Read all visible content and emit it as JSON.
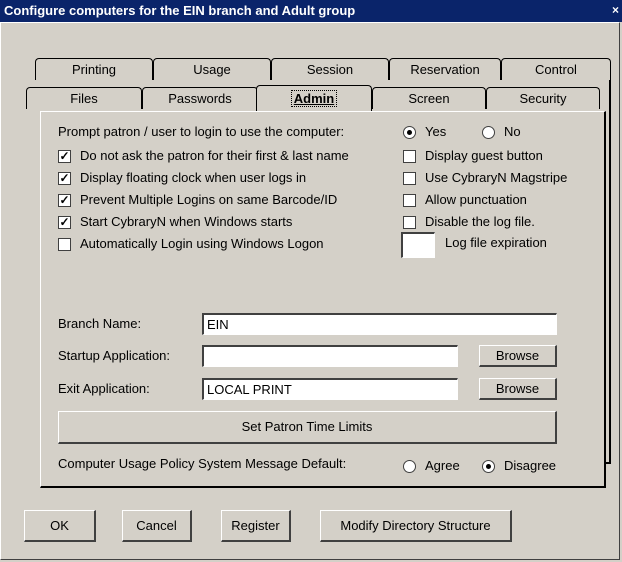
{
  "window": {
    "title": "Configure computers for the EIN branch and Adult group",
    "close": "×"
  },
  "tabs_back": [
    "Printing",
    "Usage",
    "Session",
    "Reservation",
    "Control"
  ],
  "tabs_front": [
    "Files",
    "Passwords",
    "Admin",
    "Screen",
    "Security"
  ],
  "active_tab": "Admin",
  "admin": {
    "prompt_label": "Prompt patron / user to login to use the computer:",
    "prompt_yes": "Yes",
    "prompt_no": "No",
    "prompt_selected": "Yes",
    "left_options": [
      {
        "label": "Do not ask the patron for their first & last name",
        "checked": true
      },
      {
        "label": "Display floating clock when user logs in",
        "checked": true
      },
      {
        "label": "Prevent Multiple Logins on same Barcode/ID",
        "checked": true
      },
      {
        "label": "Start CybraryN when Windows starts",
        "checked": true
      },
      {
        "label": "Automatically Login using Windows Logon",
        "checked": false
      }
    ],
    "right_options": [
      {
        "label": "Display guest button",
        "checked": false
      },
      {
        "label": "Use CybraryN Magstripe",
        "checked": false
      },
      {
        "label": "Allow punctuation",
        "checked": false
      },
      {
        "label": "Disable the log file.",
        "checked": false
      }
    ],
    "log_expiration_label": "Log file expiration",
    "log_expiration_value": "",
    "branch_label": "Branch Name:",
    "branch_value": "EIN",
    "startup_label": "Startup Application:",
    "startup_value": "",
    "exit_label": "Exit Application:",
    "exit_value": "LOCAL PRINT",
    "browse": "Browse",
    "time_limits_button": "Set Patron Time Limits",
    "policy_label": "Computer Usage Policy System Message Default:",
    "policy_agree": "Agree",
    "policy_disagree": "Disagree",
    "policy_selected": "Disagree"
  },
  "footer": {
    "ok": "OK",
    "cancel": "Cancel",
    "register": "Register",
    "modify": "Modify Directory Structure"
  },
  "colors": {
    "titlebar": "#0a246a",
    "face": "#d4d0c8"
  }
}
